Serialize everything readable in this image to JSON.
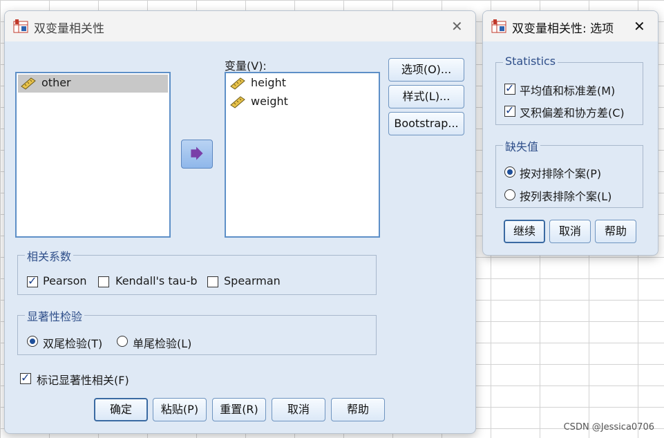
{
  "main_dialog": {
    "title": "双变量相关性",
    "source_items": [
      "other"
    ],
    "variables_label": "变量(V):",
    "variables": [
      "height",
      "weight"
    ],
    "side_buttons": [
      "选项(O)...",
      "样式(L)...",
      "Bootstrap..."
    ],
    "coef_group": {
      "legend": "相关系数",
      "options": [
        {
          "label": "Pearson",
          "checked": true
        },
        {
          "label": "Kendall's tau-b",
          "checked": false
        },
        {
          "label": "Spearman",
          "checked": false
        }
      ]
    },
    "test_group": {
      "legend": "显著性检验",
      "options": [
        {
          "label": "双尾检验(T)",
          "selected": true
        },
        {
          "label": "单尾检验(L)",
          "selected": false
        }
      ]
    },
    "flag_label": "标记显著性相关(F)",
    "flag_checked": true,
    "bottom_buttons": [
      "确定",
      "粘贴(P)",
      "重置(R)",
      "取消",
      "帮助"
    ]
  },
  "options_dialog": {
    "title": "双变量相关性: 选项",
    "stats_group": {
      "legend": "Statistics",
      "options": [
        {
          "label": "平均值和标准差(M)",
          "checked": true
        },
        {
          "label": "叉积偏差和协方差(C)",
          "checked": true
        }
      ]
    },
    "missing_group": {
      "legend": "缺失值",
      "options": [
        {
          "label": "按对排除个案(P)",
          "selected": true
        },
        {
          "label": "按列表排除个案(L)",
          "selected": false
        }
      ]
    },
    "buttons": [
      "继续",
      "取消",
      "帮助"
    ]
  },
  "watermark": "CSDN @Jessica0706",
  "colors": {
    "accent": "#1e4f9a",
    "dialog_bg": "#dfe9f5",
    "list_border": "#5d8fc7"
  }
}
